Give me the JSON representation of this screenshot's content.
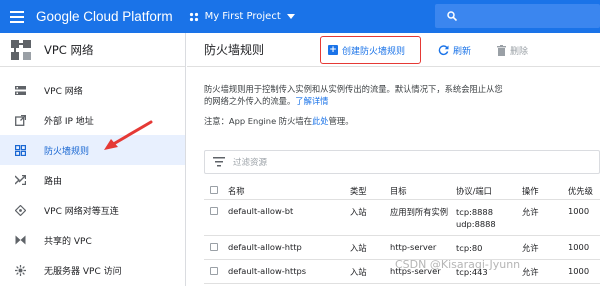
{
  "topbar": {
    "brand": "Google Cloud Platform",
    "project": "My First Project",
    "icons": {
      "menu": "menu-icon",
      "project": "project-hexagon-icon",
      "caret": "caret-down-icon",
      "search": "search-icon"
    },
    "color": "#1a73e8"
  },
  "sidebar": {
    "title": "VPC 网络",
    "items": [
      {
        "label": "VPC 网络",
        "icon": "vpc-network-icon"
      },
      {
        "label": "外部 IP 地址",
        "icon": "external-ip-icon"
      },
      {
        "label": "防火墙规则",
        "icon": "firewall-icon",
        "active": true
      },
      {
        "label": "路由",
        "icon": "routes-icon"
      },
      {
        "label": "VPC 网络对等互连",
        "icon": "peering-icon"
      },
      {
        "label": "共享的 VPC",
        "icon": "shared-vpc-icon"
      },
      {
        "label": "无服务器 VPC 访问",
        "icon": "serverless-vpc-icon"
      }
    ]
  },
  "main": {
    "title": "防火墙规则",
    "create_label": "创建防火墙规则",
    "refresh_label": "刷新",
    "delete_label": "删除",
    "description_line1": "防火墙规则用于控制传入实例和从实例传出的流量。默认情况下，系统会阻止从您",
    "description_line2": "的网络之外传入的流量。",
    "learn_more": "了解详情",
    "note_prefix": "注意：App Engine 防火墙在",
    "note_link": "此处",
    "note_suffix": "管理。",
    "filter_placeholder": "过滤资源"
  },
  "table": {
    "headers": {
      "name": "名称",
      "type": "类型",
      "target": "目标",
      "protocol": "协议/端口",
      "action": "操作",
      "priority": "优先级"
    },
    "rows": [
      {
        "name": "default-allow-bt",
        "type": "入站",
        "target": "应用到所有实例",
        "protocol_1": "tcp:8888",
        "protocol_2": "udp:8888",
        "action": "允许",
        "priority": "1000"
      },
      {
        "name": "default-allow-http",
        "type": "入站",
        "target": "http-server",
        "protocol_1": "tcp:80",
        "action": "允许",
        "priority": "1000"
      },
      {
        "name": "default-allow-https",
        "type": "入站",
        "target": "https-server",
        "protocol_1": "tcp:443",
        "action": "允许",
        "priority": "1000"
      }
    ]
  },
  "watermark": "CSDN @Kisaragi-Jyunn",
  "colors": {
    "accent": "#1a73e8",
    "highlight_box": "#e53935",
    "arrow": "#e53935"
  }
}
